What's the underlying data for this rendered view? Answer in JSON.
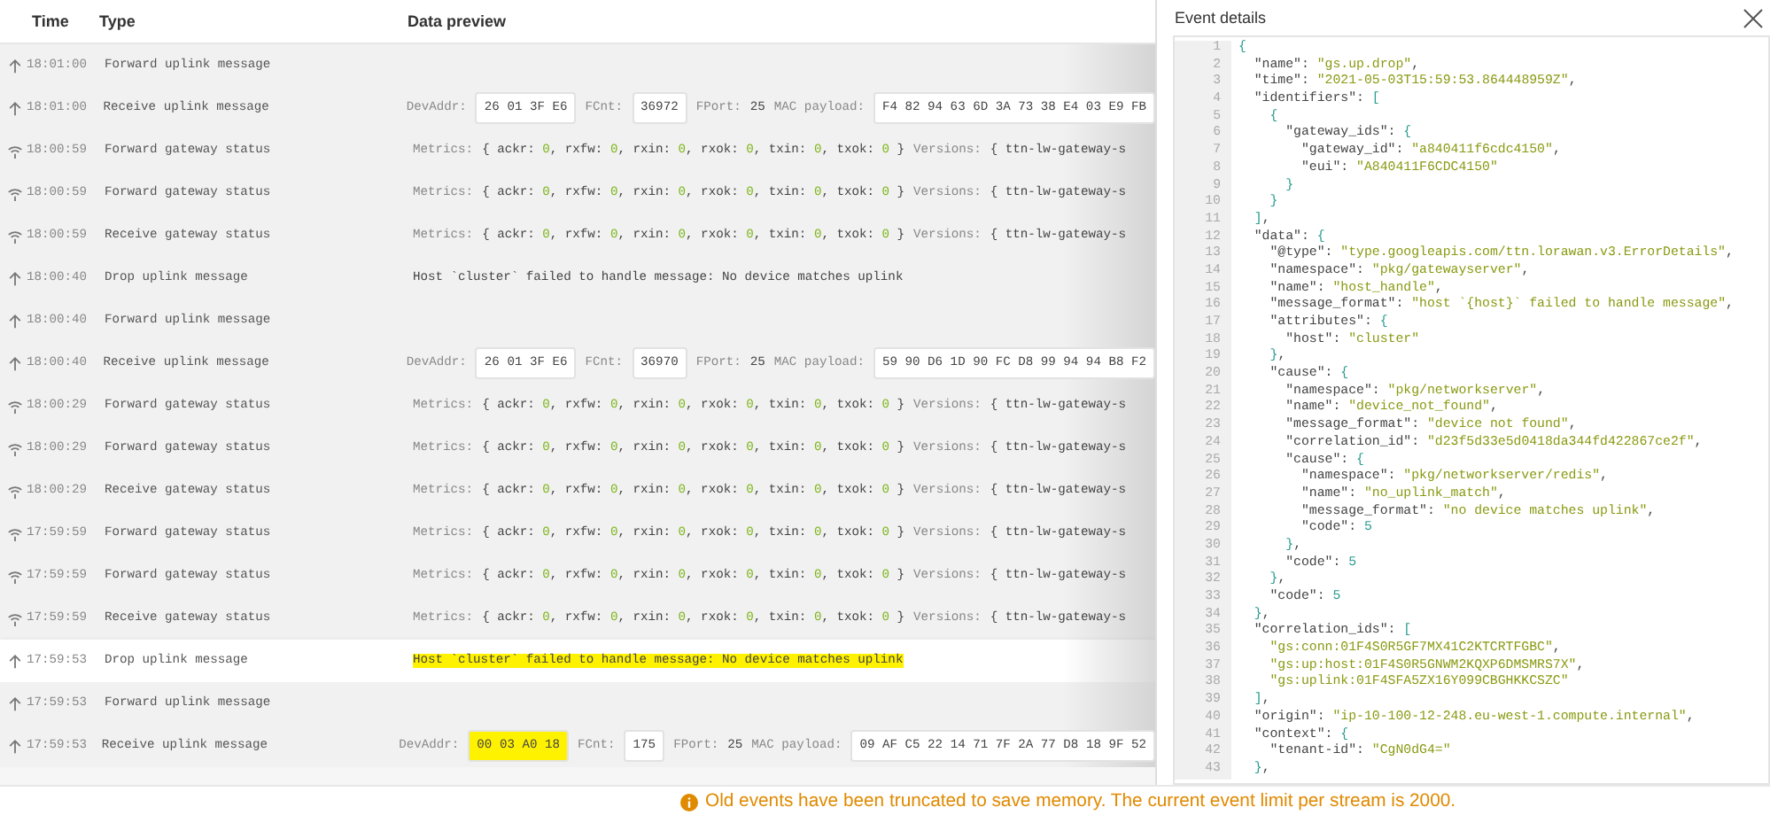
{
  "table": {
    "columns": [
      "Time",
      "Type",
      "Data preview"
    ],
    "rows": [
      {
        "kind": "uplink",
        "time": "18:01:00",
        "type": "Forward uplink message",
        "selected": false,
        "preview": []
      },
      {
        "kind": "uplink",
        "time": "18:01:00",
        "type": "Receive uplink message",
        "selected": false,
        "preview": [
          {
            "kind": "box",
            "label": "DevAddr:",
            "value": "26 01 3F E6",
            "highlighted": false
          },
          {
            "kind": "box",
            "label": "FCnt:",
            "value": "36972",
            "highlighted": false
          },
          {
            "kind": "text",
            "label": "FPort:",
            "value": "25",
            "highlighted": false
          },
          {
            "kind": "box",
            "label": "MAC payload:",
            "value": "F4 82 94 63 6D 3A 73 38 E4 03 E9 FB",
            "highlighted": false
          }
        ]
      },
      {
        "kind": "gateway",
        "time": "18:00:59",
        "type": "Forward gateway status",
        "selected": false,
        "preview": [
          {
            "kind": "metrics",
            "label": "Metrics:",
            "value": "{ ackr: 0, rxfw: 0, rxin: 0, rxok: 0, txin: 0, txok: 0 }",
            "highlighted": false
          },
          {
            "kind": "text",
            "label": "Versions:",
            "value": "{ ttn-lw-gateway-s",
            "highlighted": false
          }
        ]
      },
      {
        "kind": "gateway",
        "time": "18:00:59",
        "type": "Forward gateway status",
        "selected": false,
        "preview": [
          {
            "kind": "metrics",
            "label": "Metrics:",
            "value": "{ ackr: 0, rxfw: 0, rxin: 0, rxok: 0, txin: 0, txok: 0 }",
            "highlighted": false
          },
          {
            "kind": "text",
            "label": "Versions:",
            "value": "{ ttn-lw-gateway-s",
            "highlighted": false
          }
        ]
      },
      {
        "kind": "gateway",
        "time": "18:00:59",
        "type": "Receive gateway status",
        "selected": false,
        "preview": [
          {
            "kind": "metrics",
            "label": "Metrics:",
            "value": "{ ackr: 0, rxfw: 0, rxin: 0, rxok: 0, txin: 0, txok: 0 }",
            "highlighted": false
          },
          {
            "kind": "text",
            "label": "Versions:",
            "value": "{ ttn-lw-gateway-s",
            "highlighted": false
          }
        ]
      },
      {
        "kind": "uplink",
        "time": "18:00:40",
        "type": "Drop uplink message",
        "selected": false,
        "preview": [
          {
            "kind": "text",
            "value": "Host `cluster` failed to handle message: No device matches uplink",
            "highlighted": false
          }
        ]
      },
      {
        "kind": "uplink",
        "time": "18:00:40",
        "type": "Forward uplink message",
        "selected": false,
        "preview": []
      },
      {
        "kind": "uplink",
        "time": "18:00:40",
        "type": "Receive uplink message",
        "selected": false,
        "preview": [
          {
            "kind": "box",
            "label": "DevAddr:",
            "value": "26 01 3F E6",
            "highlighted": false
          },
          {
            "kind": "box",
            "label": "FCnt:",
            "value": "36970",
            "highlighted": false
          },
          {
            "kind": "text",
            "label": "FPort:",
            "value": "25",
            "highlighted": false
          },
          {
            "kind": "box",
            "label": "MAC payload:",
            "value": "59 90 D6 1D 90 FC D8 99 94 94 B8 F2",
            "highlighted": false
          }
        ]
      },
      {
        "kind": "gateway",
        "time": "18:00:29",
        "type": "Forward gateway status",
        "selected": false,
        "preview": [
          {
            "kind": "metrics",
            "label": "Metrics:",
            "value": "{ ackr: 0, rxfw: 0, rxin: 0, rxok: 0, txin: 0, txok: 0 }",
            "highlighted": false
          },
          {
            "kind": "text",
            "label": "Versions:",
            "value": "{ ttn-lw-gateway-s",
            "highlighted": false
          }
        ]
      },
      {
        "kind": "gateway",
        "time": "18:00:29",
        "type": "Forward gateway status",
        "selected": false,
        "preview": [
          {
            "kind": "metrics",
            "label": "Metrics:",
            "value": "{ ackr: 0, rxfw: 0, rxin: 0, rxok: 0, txin: 0, txok: 0 }",
            "highlighted": false
          },
          {
            "kind": "text",
            "label": "Versions:",
            "value": "{ ttn-lw-gateway-s",
            "highlighted": false
          }
        ]
      },
      {
        "kind": "gateway",
        "time": "18:00:29",
        "type": "Receive gateway status",
        "selected": false,
        "preview": [
          {
            "kind": "metrics",
            "label": "Metrics:",
            "value": "{ ackr: 0, rxfw: 0, rxin: 0, rxok: 0, txin: 0, txok: 0 }",
            "highlighted": false
          },
          {
            "kind": "text",
            "label": "Versions:",
            "value": "{ ttn-lw-gateway-s",
            "highlighted": false
          }
        ]
      },
      {
        "kind": "gateway",
        "time": "17:59:59",
        "type": "Forward gateway status",
        "selected": false,
        "preview": [
          {
            "kind": "metrics",
            "label": "Metrics:",
            "value": "{ ackr: 0, rxfw: 0, rxin: 0, rxok: 0, txin: 0, txok: 0 }",
            "highlighted": false
          },
          {
            "kind": "text",
            "label": "Versions:",
            "value": "{ ttn-lw-gateway-s",
            "highlighted": false
          }
        ]
      },
      {
        "kind": "gateway",
        "time": "17:59:59",
        "type": "Forward gateway status",
        "selected": false,
        "preview": [
          {
            "kind": "metrics",
            "label": "Metrics:",
            "value": "{ ackr: 0, rxfw: 0, rxin: 0, rxok: 0, txin: 0, txok: 0 }",
            "highlighted": false
          },
          {
            "kind": "text",
            "label": "Versions:",
            "value": "{ ttn-lw-gateway-s",
            "highlighted": false
          }
        ]
      },
      {
        "kind": "gateway",
        "time": "17:59:59",
        "type": "Receive gateway status",
        "selected": false,
        "preview": [
          {
            "kind": "metrics",
            "label": "Metrics:",
            "value": "{ ackr: 0, rxfw: 0, rxin: 0, rxok: 0, txin: 0, txok: 0 }",
            "highlighted": false
          },
          {
            "kind": "text",
            "label": "Versions:",
            "value": "{ ttn-lw-gateway-s",
            "highlighted": false
          }
        ]
      },
      {
        "kind": "uplink",
        "time": "17:59:53",
        "type": "Drop uplink message",
        "selected": true,
        "preview": [
          {
            "kind": "text",
            "value": "Host `cluster` failed to handle message: No device matches uplink",
            "highlighted": true
          }
        ]
      },
      {
        "kind": "uplink",
        "time": "17:59:53",
        "type": "Forward uplink message",
        "selected": false,
        "preview": []
      },
      {
        "kind": "uplink",
        "time": "17:59:53",
        "type": "Receive uplink message",
        "selected": false,
        "preview": [
          {
            "kind": "box",
            "label": "DevAddr:",
            "value": "00 03 A0 18",
            "highlighted": true
          },
          {
            "kind": "box",
            "label": "FCnt:",
            "value": "175",
            "highlighted": false
          },
          {
            "kind": "text",
            "label": "FPort:",
            "value": "25",
            "highlighted": false
          },
          {
            "kind": "box",
            "label": "MAC payload:",
            "value": "09 AF C5 22 14 71 7F 2A 77 D8 18 9F 52",
            "highlighted": false
          }
        ]
      }
    ]
  },
  "panel": {
    "title": "Event details",
    "lines": [
      {
        "n": "1",
        "text": "{"
      },
      {
        "n": "2",
        "text": "  \"name\": \"gs.up.drop\","
      },
      {
        "n": "3",
        "text": "  \"time\": \"2021-05-03T15:59:53.864448959Z\","
      },
      {
        "n": "4",
        "text": "  \"identifiers\": ["
      },
      {
        "n": "5",
        "text": "    {"
      },
      {
        "n": "6",
        "text": "      \"gateway_ids\": {"
      },
      {
        "n": "7",
        "text": "        \"gateway_id\": \"a840411f6cdc4150\","
      },
      {
        "n": "8",
        "text": "        \"eui\": \"A840411F6CDC4150\""
      },
      {
        "n": "9",
        "text": "      }"
      },
      {
        "n": "10",
        "text": "    }"
      },
      {
        "n": "11",
        "text": "  ],"
      },
      {
        "n": "12",
        "text": "  \"data\": {"
      },
      {
        "n": "13",
        "text": "    \"@type\": \"type.googleapis.com/ttn.lorawan.v3.ErrorDetails\","
      },
      {
        "n": "14",
        "text": "    \"namespace\": \"pkg/gatewayserver\","
      },
      {
        "n": "15",
        "text": "    \"name\": \"host_handle\","
      },
      {
        "n": "16",
        "text": "    \"message_format\": \"host `{host}` failed to handle message\","
      },
      {
        "n": "17",
        "text": "    \"attributes\": {"
      },
      {
        "n": "18",
        "text": "      \"host\": \"cluster\""
      },
      {
        "n": "19",
        "text": "    },"
      },
      {
        "n": "20",
        "text": "    \"cause\": {"
      },
      {
        "n": "21",
        "text": "      \"namespace\": \"pkg/networkserver\","
      },
      {
        "n": "22",
        "text": "      \"name\": \"device_not_found\","
      },
      {
        "n": "23",
        "text": "      \"message_format\": \"device not found\","
      },
      {
        "n": "24",
        "text": "      \"correlation_id\": \"d23f5d33e5d0418da344fd422867ce2f\","
      },
      {
        "n": "25",
        "text": "      \"cause\": {"
      },
      {
        "n": "26",
        "text": "        \"namespace\": \"pkg/networkserver/redis\","
      },
      {
        "n": "27",
        "text": "        \"name\": \"no_uplink_match\","
      },
      {
        "n": "28",
        "text": "        \"message_format\": \"no device matches uplink\","
      },
      {
        "n": "29",
        "text": "        \"code\": 5"
      },
      {
        "n": "30",
        "text": "      },"
      },
      {
        "n": "31",
        "text": "      \"code\": 5"
      },
      {
        "n": "32",
        "text": "    },"
      },
      {
        "n": "33",
        "text": "    \"code\": 5"
      },
      {
        "n": "34",
        "text": "  },"
      },
      {
        "n": "35",
        "text": "  \"correlation_ids\": ["
      },
      {
        "n": "36",
        "text": "    \"gs:conn:01F4S0R5GF7MX41C2KTCRTFGBC\","
      },
      {
        "n": "37",
        "text": "    \"gs:up:host:01F4S0R5GNWM2KQXP6DMSMRS7X\","
      },
      {
        "n": "38",
        "text": "    \"gs:uplink:01F4SFA5ZX16Y099CBGHKKCSZC\""
      },
      {
        "n": "39",
        "text": "  ],"
      },
      {
        "n": "40",
        "text": "  \"origin\": \"ip-10-100-12-248.eu-west-1.compute.internal\","
      },
      {
        "n": "41",
        "text": "  \"context\": {"
      },
      {
        "n": "42",
        "text": "    \"tenant-id\": \"CgN0dG4=\""
      },
      {
        "n": "43",
        "text": "  },"
      }
    ]
  },
  "notice": "Old events have been truncated to save memory. The current event limit per stream is 2000."
}
